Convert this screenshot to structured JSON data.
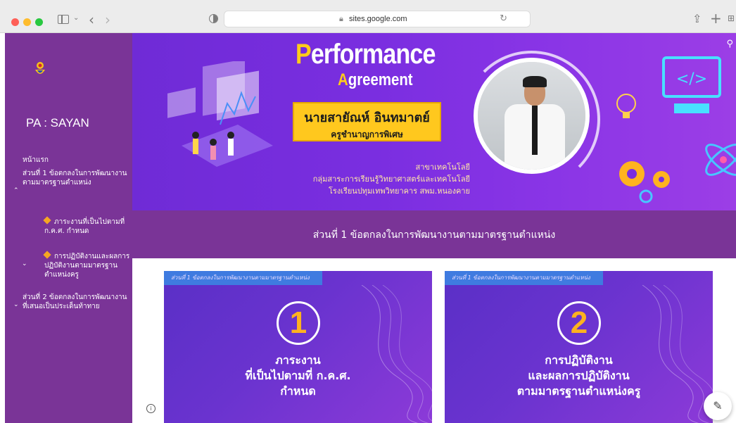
{
  "browser": {
    "url": "sites.google.com",
    "icons": [
      "sidebar-toggle-icon",
      "chevron-down-icon",
      "back-arrow-icon",
      "forward-arrow-icon",
      "privacy-shield-icon",
      "lock-icon",
      "reload-icon",
      "share-icon",
      "new-tab-icon",
      "tab-overview-icon"
    ]
  },
  "sidebar": {
    "site_title": "PA : SAYAN",
    "items": [
      {
        "label": "หน้าแรก"
      },
      {
        "label": "ส่วนที่ 1 ข้อตกลงในการพัฒนางานตามมาตรฐานตำแหน่ง"
      },
      {
        "label": "ภาระงานที่เป็นไปตามที่ ก.ค.ศ. กำหนด"
      },
      {
        "label": "การปฏิบัติงานและผลการปฏิบัติงานตามมาตรฐานตำแหน่งครู"
      },
      {
        "label": "ส่วนที่ 2 ข้อตกลงในการพัฒนางานที่เสนอเป็นประเด็นท้าทาย"
      }
    ]
  },
  "banner": {
    "title_first": "P",
    "title_rest": "erformance",
    "subtitle_first": "A",
    "subtitle_rest": "greement",
    "name": "นายสายัณห์ อินทมาตย์",
    "role": "ครูชำนาญการพิเศษ",
    "line1": "สาขาเทคโนโลยี",
    "line2": "กลุ่มสาระการเรียนรู้วิทยาศาสตร์และเทคโนโลยี",
    "line3": "โรงเรียนปทุมเทพวิทยาคาร สพม.หนองคาย"
  },
  "section": {
    "heading": "ส่วนที่ 1 ข้อตกลงในการพัฒนางานตามมาตรฐานตำแหน่ง"
  },
  "cards": [
    {
      "tag": "ส่วนที่ 1 ข้อตกลงในการพัฒนางานตามมาตรฐานตำแหน่ง",
      "number": "1",
      "lines": [
        "ภาระงาน",
        "ที่เป็นไปตามที่ ก.ค.ศ.",
        "กำหนด"
      ]
    },
    {
      "tag": "ส่วนที่ 1 ข้อตกลงในการพัฒนางานตามมาตรฐานตำแหน่ง",
      "number": "2",
      "lines": [
        "การปฏิบัติงาน",
        "และผลการปฏิบัติงาน",
        "ตามมาตรฐานตำแหน่งครู"
      ]
    }
  ],
  "colors": {
    "nav_purple": "#7a3497",
    "banner_purple": "#7a2ee0",
    "accent_yellow": "#ffc81e",
    "card_blue": "#5a2fc6"
  }
}
